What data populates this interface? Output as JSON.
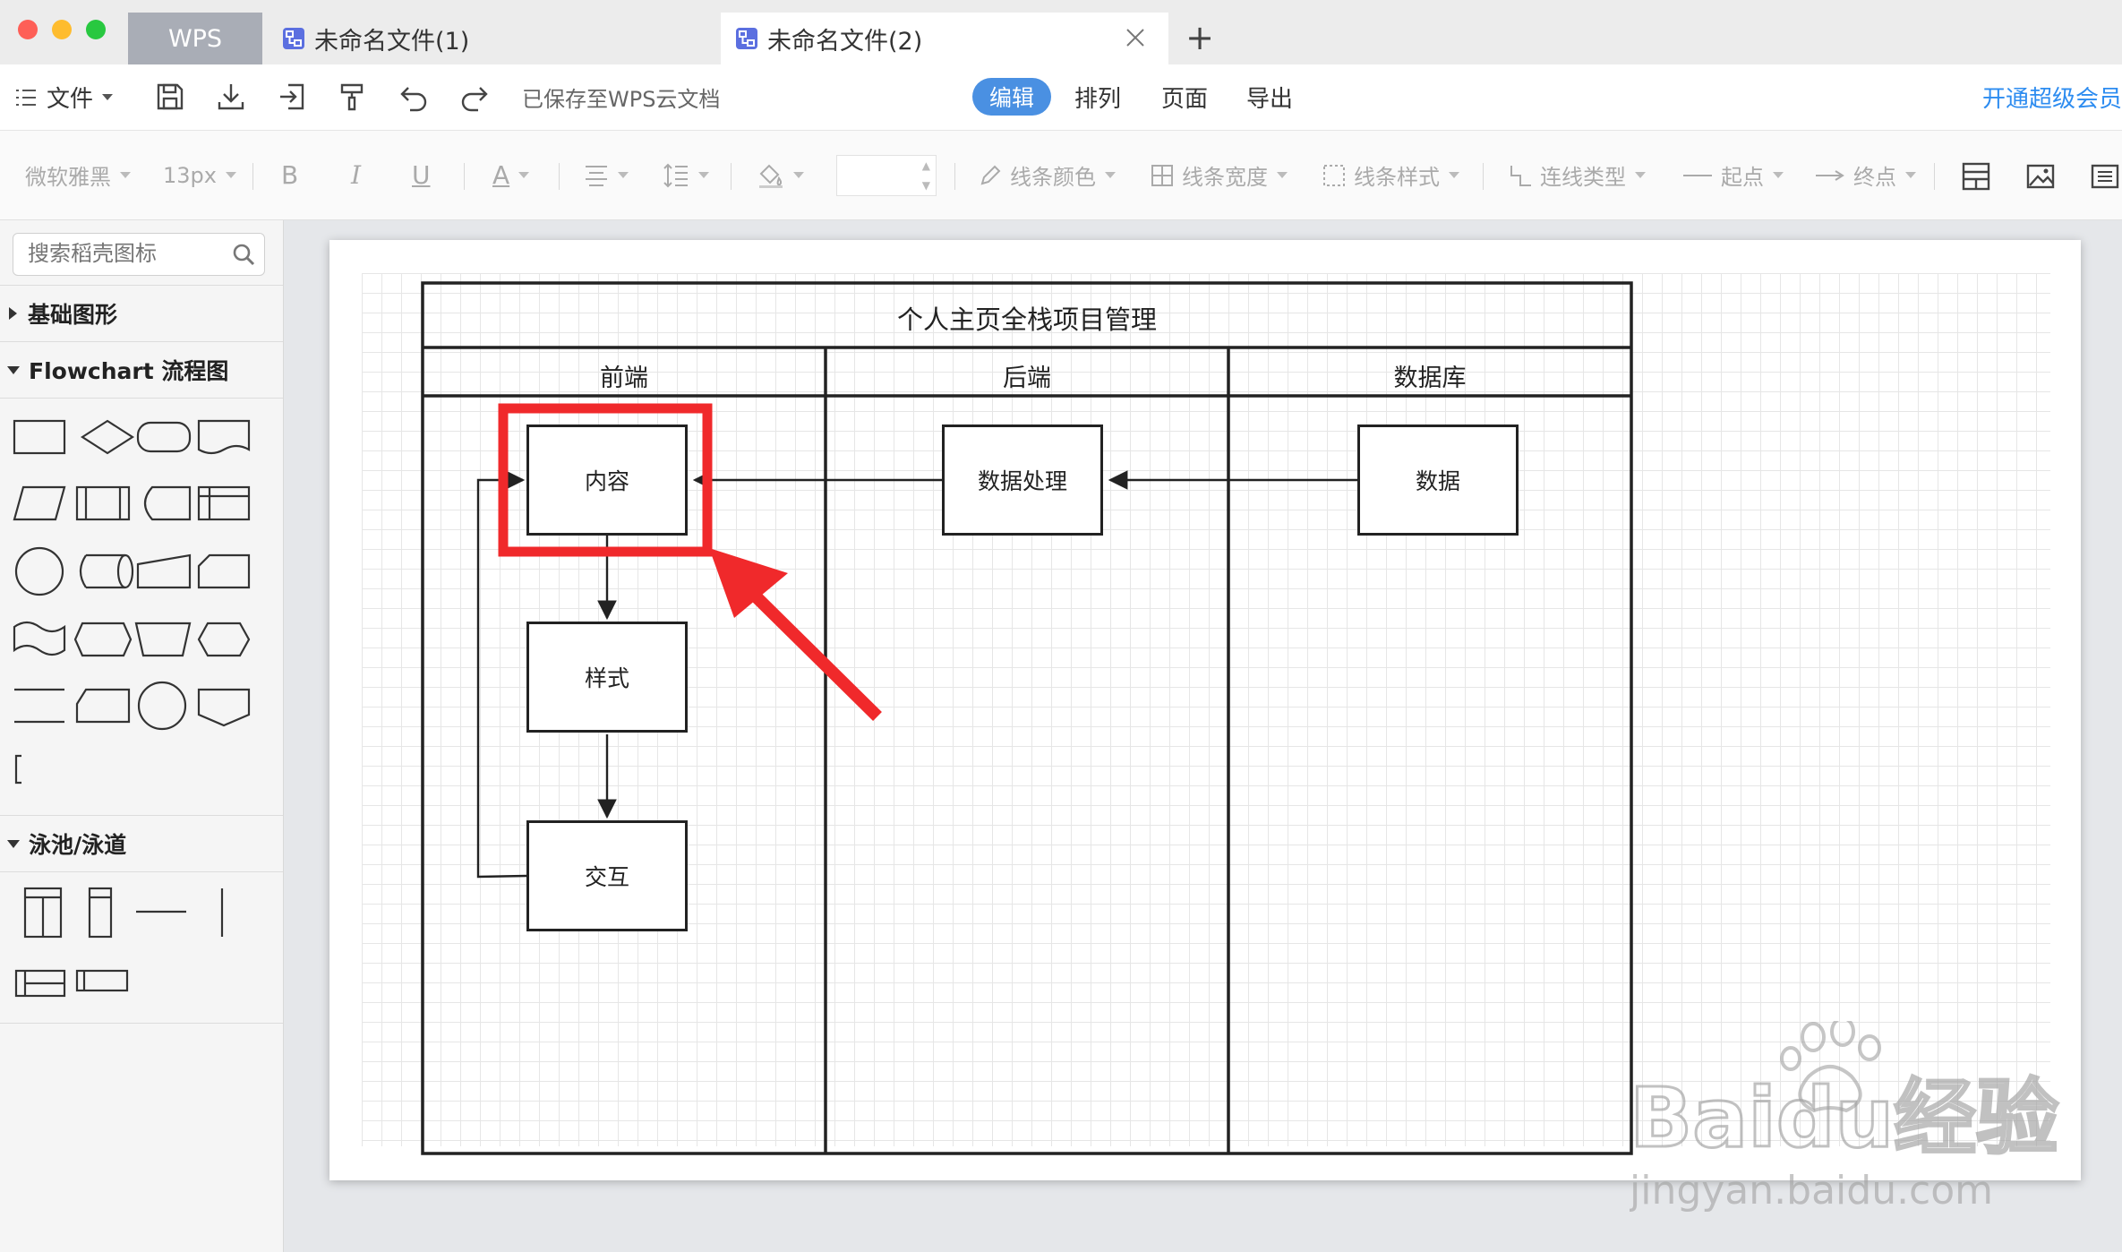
{
  "window": {
    "traffic_lights": [
      "#fe5f57",
      "#febc2e",
      "#28c840"
    ]
  },
  "tabs": {
    "home": "WPS",
    "items": [
      {
        "label": "未命名文件(1)"
      },
      {
        "label": "未命名文件(2)"
      }
    ],
    "add": "+"
  },
  "menubar": {
    "file": "文件",
    "saved_status": "已保存至WPS云文档",
    "modes": [
      "编辑",
      "排列",
      "页面",
      "导出"
    ],
    "vip": "开通超级会员"
  },
  "format_toolbar": {
    "font_family": "微软雅黑",
    "font_size": "13px",
    "bold": "B",
    "italic": "I",
    "underline": "U",
    "font_color": "A",
    "line_color": "线条颜色",
    "line_width": "线条宽度",
    "line_style": "线条样式",
    "connector_type": "连线类型",
    "start_point": "起点",
    "end_point": "终点"
  },
  "sidebar": {
    "search_placeholder": "搜索稻壳图标",
    "sections": [
      {
        "label": "基础图形",
        "expanded": false
      },
      {
        "label": "Flowchart 流程图",
        "expanded": true
      },
      {
        "label": "泳池/泳道",
        "expanded": true
      }
    ]
  },
  "diagram": {
    "title": "个人主页全栈项目管理",
    "lanes": [
      "前端",
      "后端",
      "数据库"
    ],
    "nodes": {
      "content": "内容",
      "style": "样式",
      "interaction": "交互",
      "data_processing": "数据处理",
      "data": "数据"
    },
    "highlight_color": "#f0292b"
  },
  "watermark": {
    "brand": "Baidu经验",
    "url": "jingyan.baidu.com"
  },
  "colors": {
    "accent": "#4a90e2",
    "vip_link": "#2d8cf0",
    "arrow_red": "#f0292b"
  }
}
